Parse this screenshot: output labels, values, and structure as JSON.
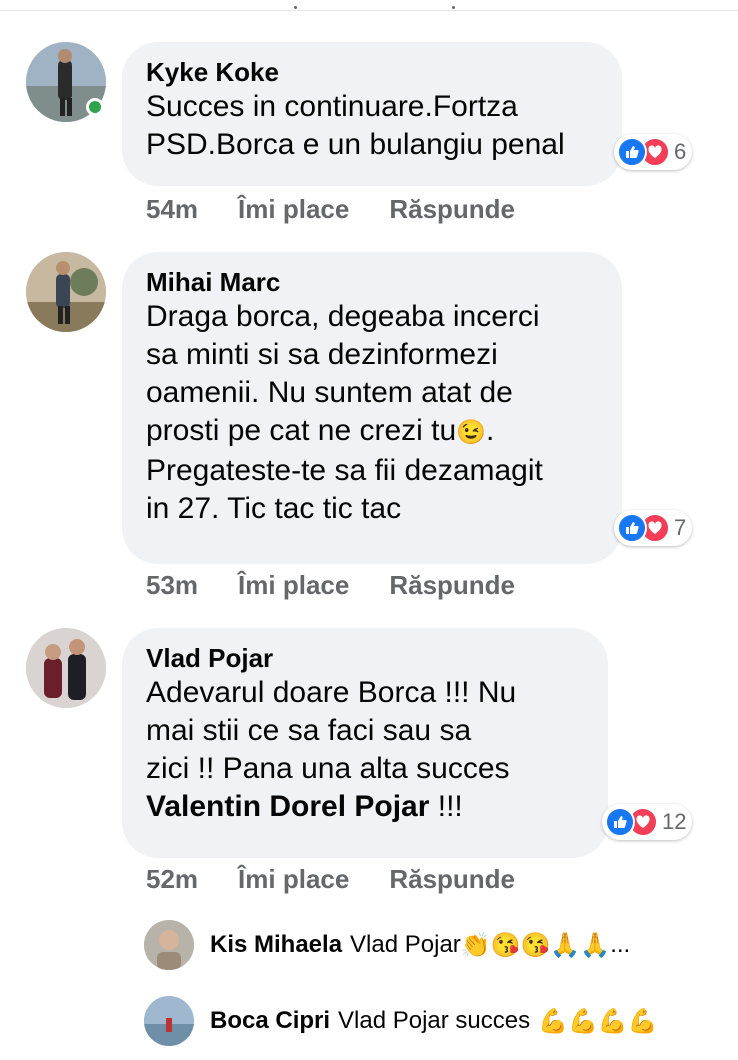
{
  "comments": [
    {
      "author": "Kyke Koke",
      "lines": [
        "Succes in continuare.Fortza",
        "PSD.Borca e un bulangiu penal"
      ],
      "reaction_count": "6",
      "time": "54m",
      "like_label": "Îmi place",
      "reply_label": "Răspunde"
    },
    {
      "author": "Mihai Marc",
      "lines": [
        "Draga borca, degeaba incerci",
        "sa minti si sa dezinformezi",
        "oamenii. Nu suntem atat de",
        "prosti pe cat ne crezi tu",
        "Pregateste-te sa fii dezamagit",
        "in 27. Tic tac tic tac"
      ],
      "emoji_inline": "😉",
      "after_emoji": ".",
      "reaction_count": "7",
      "time": "53m",
      "like_label": "Îmi place",
      "reply_label": "Răspunde"
    },
    {
      "author": "Vlad Pojar",
      "lines": [
        "Adevarul doare Borca !!!  Nu",
        "mai stii ce sa faci sau sa",
        "zici !! Pana una alta succes"
      ],
      "mention": "Valentin Dorel Pojar",
      "mention_suffix": " !!!",
      "reaction_count": "12",
      "time": "52m",
      "like_label": "Îmi place",
      "reply_label": "Răspunde"
    }
  ],
  "replies": [
    {
      "author": "Kis Mihaela",
      "text": "Vlad Pojar",
      "emojis": "👏😘😘🙏🙏",
      "ellipsis": " ..."
    },
    {
      "author": "Boca Cipri",
      "text": "Vlad Pojar succes",
      "emojis": "💪💪💪💪"
    }
  ],
  "colors": {
    "like": "#1877f2",
    "love": "#f33e58",
    "online": "#31a24c",
    "bubble": "#f0f2f5",
    "meta": "#65676b"
  }
}
